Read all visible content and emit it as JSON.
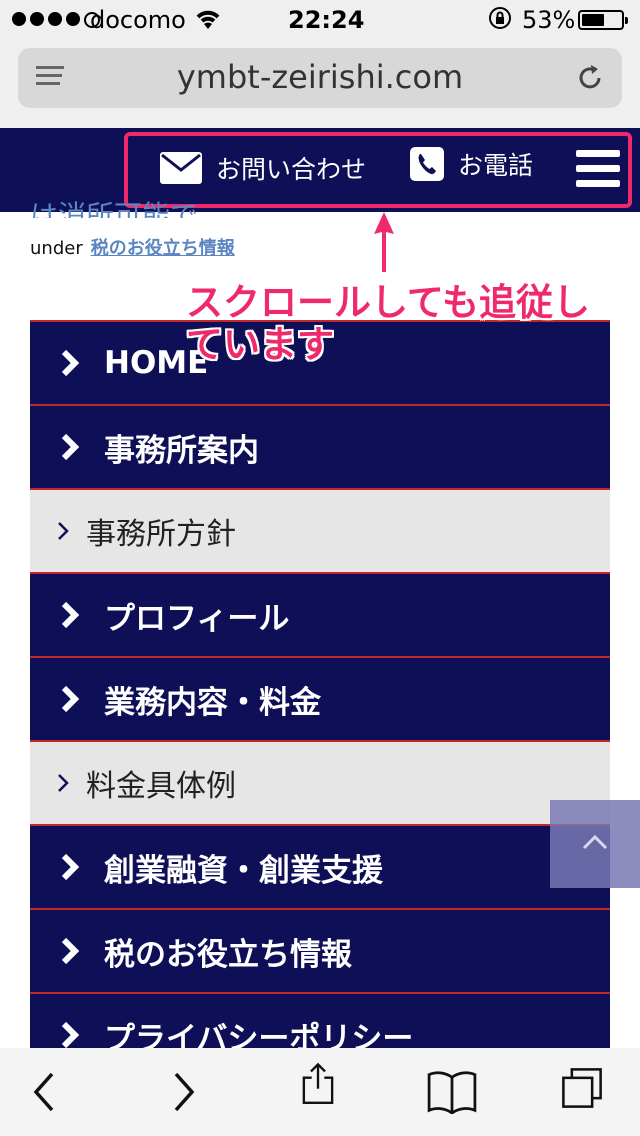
{
  "status_bar": {
    "carrier": "docomo",
    "time": "22:24",
    "battery_percent": "53%"
  },
  "browser": {
    "url": "ymbt-zeirishi.com"
  },
  "header": {
    "contact_label": "お問い合わせ",
    "phone_label": "お電話"
  },
  "page": {
    "partial_text": "は消所可能で",
    "breadcrumb_prefix": "under",
    "breadcrumb_link": "税のお役立ち情報"
  },
  "annotation": {
    "text": "スクロールしても追従しています",
    "color": "#ee2a6b"
  },
  "nav": {
    "items": [
      {
        "label": "HOME",
        "type": "main"
      },
      {
        "label": "事務所案内",
        "type": "main"
      },
      {
        "label": "事務所方針",
        "type": "sub"
      },
      {
        "label": "プロフィール",
        "type": "main"
      },
      {
        "label": "業務内容・料金",
        "type": "main"
      },
      {
        "label": "料金具体例",
        "type": "sub"
      },
      {
        "label": "創業融資・創業支援",
        "type": "main"
      },
      {
        "label": "税のお役立ち情報",
        "type": "main"
      },
      {
        "label": "プライバシーポリシー",
        "type": "main"
      }
    ]
  },
  "colors": {
    "navy": "#0f0f58",
    "divider": "#c4242b",
    "sub_bg": "#e6e6e6"
  }
}
